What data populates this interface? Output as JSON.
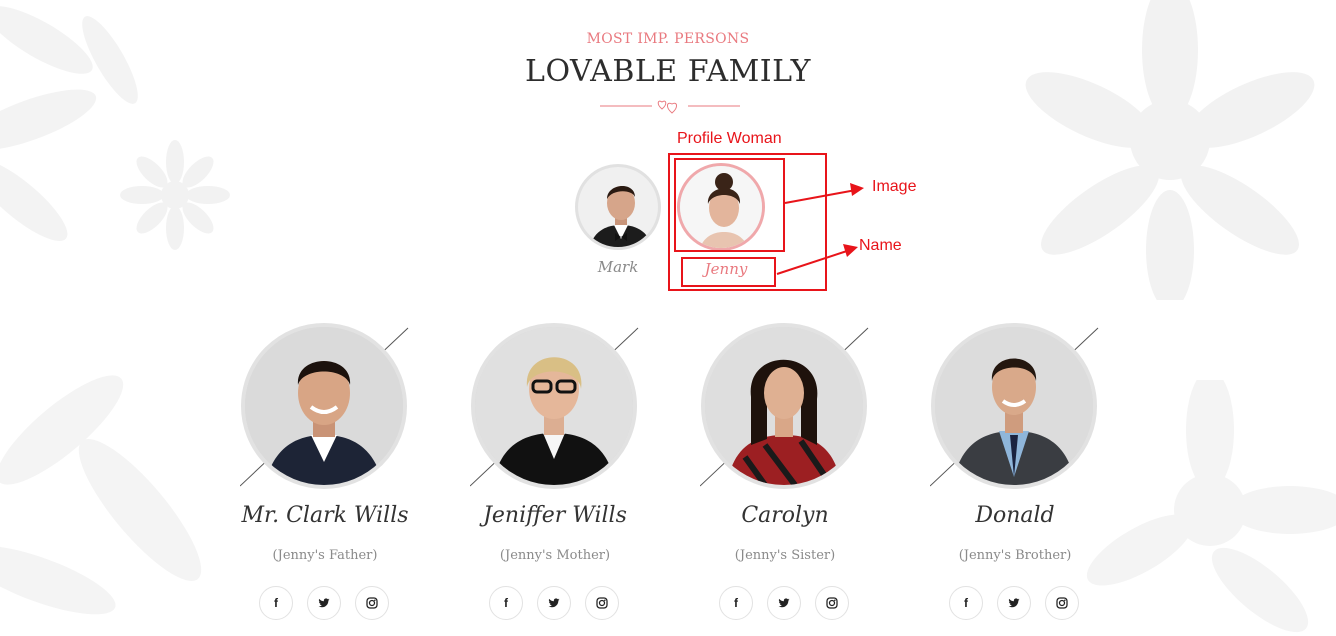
{
  "header": {
    "kicker": "MOST IMP. PERSONS",
    "title": "LOVABLE FAMILY",
    "divider_icon": "hearts-icon"
  },
  "couple": {
    "groom": {
      "name": "Mark"
    },
    "bride": {
      "name": "Jenny"
    }
  },
  "annotations": {
    "profile_label": "Profile Woman",
    "image_label": "Image",
    "name_label": "Name",
    "color": "#e8141a"
  },
  "members": [
    {
      "name": "Mr. Clark Wills",
      "role": "(Jenny's Father)"
    },
    {
      "name": "Jeniffer Wills",
      "role": "(Jenny's Mother)"
    },
    {
      "name": "Carolyn",
      "role": "(Jenny's Sister)"
    },
    {
      "name": "Donald",
      "role": "(Jenny's Brother)"
    }
  ],
  "social": {
    "facebook": "f",
    "twitter": "twitter-icon",
    "instagram": "instagram-icon"
  },
  "colors": {
    "accent": "#e9797f",
    "text": "#2d2d2d",
    "muted": "#8a8a8a"
  }
}
